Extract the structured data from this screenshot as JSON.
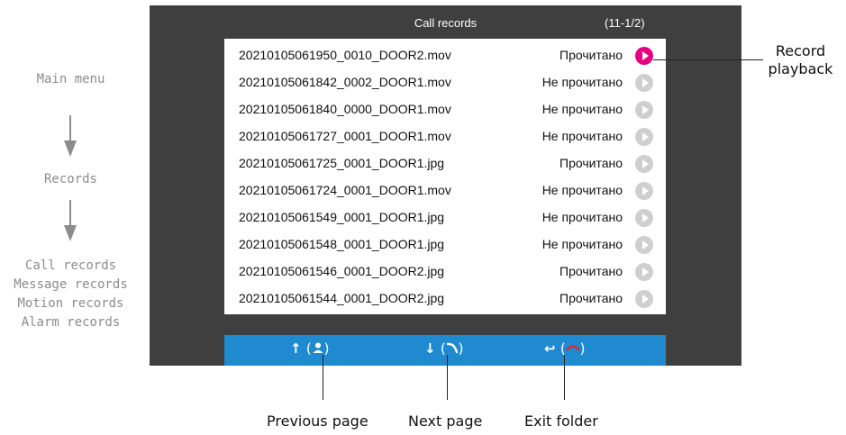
{
  "flow": {
    "main_menu": "Main menu",
    "records": "Records",
    "items": [
      "Call records",
      "Message records",
      "Motion records",
      "Alarm records"
    ]
  },
  "screen": {
    "title": "Call records",
    "page_indicator": "(11-1/2)",
    "rows": [
      {
        "file": "20210105061950_0010_DOOR2.mov",
        "status": "Прочитано"
      },
      {
        "file": "20210105061842_0002_DOOR1.mov",
        "status": "Не прочитано"
      },
      {
        "file": "20210105061840_0000_DOOR1.mov",
        "status": "Не прочитано"
      },
      {
        "file": "20210105061727_0001_DOOR1.mov",
        "status": "Не прочитано"
      },
      {
        "file": "20210105061725_0001_DOOR1.jpg",
        "status": "Прочитано"
      },
      {
        "file": "20210105061724_0001_DOOR1.mov",
        "status": "Не прочитано"
      },
      {
        "file": "20210105061549_0001_DOOR1.jpg",
        "status": "Не прочитано"
      },
      {
        "file": "20210105061548_0001_DOOR1.jpg",
        "status": "Не прочитано"
      },
      {
        "file": "20210105061546_0001_DOOR2.jpg",
        "status": "Прочитано"
      },
      {
        "file": "20210105061544_0001_DOOR2.jpg",
        "status": "Прочитано"
      }
    ],
    "bottom": {
      "prev_arrow": "↑",
      "next_arrow": "↓",
      "exit_arrow": "↩",
      "open_paren": "(",
      "close_paren": ")"
    }
  },
  "callouts": {
    "record_playback": [
      "Record",
      "playback"
    ],
    "previous_page": "Previous page",
    "next_page": "Next page",
    "exit_folder": "Exit folder"
  },
  "colors": {
    "screen_bg": "#3f3f3f",
    "bar_blue": "#1f8ad0",
    "active_play": "#e6007e",
    "inactive_play": "#cfcfcf",
    "hangup_red": "#e5252a"
  }
}
